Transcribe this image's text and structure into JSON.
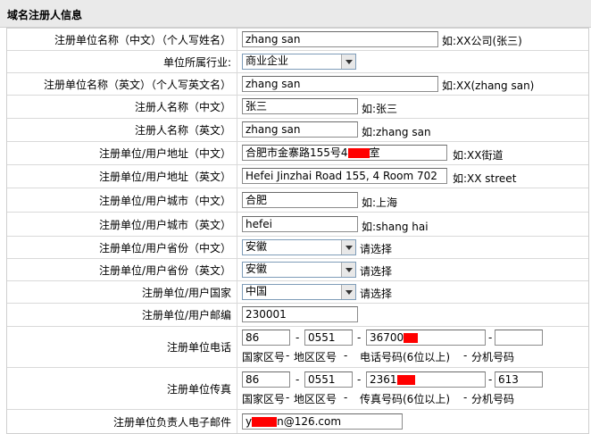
{
  "section_title": "域名注册人信息",
  "rows": {
    "org_cn": {
      "label": "注册单位名称（中文）（个人写姓名）",
      "value": "zhang san",
      "hint": "如:XX公司(张三)"
    },
    "industry": {
      "label": "单位所属行业:",
      "value": "商业企业"
    },
    "org_en": {
      "label": "注册单位名称（英文）（个人写英文名）",
      "value": "zhang san",
      "hint": "如:XX(zhang san)"
    },
    "name_cn": {
      "label": "注册人名称（中文）",
      "value": "张三",
      "hint": "如:张三"
    },
    "name_en": {
      "label": "注册人名称（英文）",
      "value": "zhang san",
      "hint": "如:zhang san"
    },
    "addr_cn": {
      "label": "注册单位/用户地址（中文）",
      "value_pre": "合肥市金寨路155号4",
      "value_post": "室",
      "hint": "如:XX街道"
    },
    "addr_en": {
      "label": "注册单位/用户地址（英文）",
      "value": "Hefei Jinzhai Road 155, 4 Room 702",
      "hint": "如:XX street"
    },
    "city_cn": {
      "label": "注册单位/用户城市（中文）",
      "value": "合肥",
      "hint": "如:上海"
    },
    "city_en": {
      "label": "注册单位/用户城市（英文）",
      "value": "hefei",
      "hint": "如:shang hai"
    },
    "prov_cn": {
      "label": "注册单位/用户省份（中文）",
      "value": "安徽",
      "hint": "请选择"
    },
    "prov_en": {
      "label": "注册单位/用户省份（英文）",
      "value": "安徽",
      "hint": "请选择"
    },
    "country": {
      "label": "注册单位/用户国家",
      "value": "中国",
      "hint": "请选择"
    },
    "postcode": {
      "label": "注册单位/用户邮编",
      "value": "230001"
    },
    "phone": {
      "label": "注册单位电话",
      "country_code": "86",
      "area_code": "0551",
      "number": "36700",
      "ext": "",
      "dash": "-",
      "sub_country": "国家区号",
      "sub_area": "地区区号",
      "sub_number": "电话号码(6位以上)",
      "sub_ext": "分机号码"
    },
    "fax": {
      "label": "注册单位传真",
      "country_code": "86",
      "area_code": "0551",
      "number": "2361",
      "ext": "613",
      "dash": "-",
      "sub_country": "国家区号",
      "sub_area": "地区区号",
      "sub_number": "传真号码(6位以上)",
      "sub_ext": "分机号码"
    },
    "email": {
      "label": "注册单位负责人电子邮件",
      "value_pre": "y",
      "value_post": "n@126.com"
    }
  },
  "colors": {
    "redaction": "#ff0000",
    "header_bg": "#eaeaea"
  }
}
